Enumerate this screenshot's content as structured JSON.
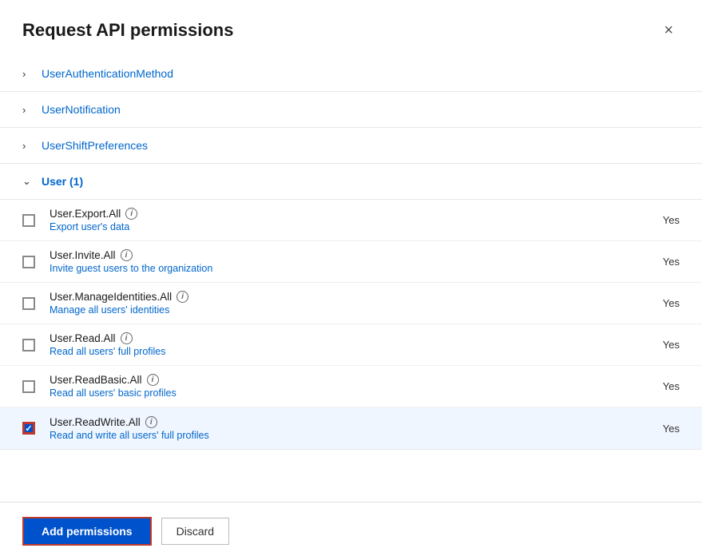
{
  "dialog": {
    "title": "Request API permissions",
    "close_label": "×"
  },
  "collapsed_sections": [
    {
      "id": "UserAuthenticationMethod",
      "label": "UserAuthenticationMethod",
      "expanded": false
    },
    {
      "id": "UserNotification",
      "label": "UserNotification",
      "expanded": false
    },
    {
      "id": "UserShiftPreferences",
      "label": "UserShiftPreferences",
      "expanded": false
    }
  ],
  "expanded_section": {
    "label": "User (1)",
    "permissions": [
      {
        "id": "User.Export.All",
        "name": "User.Export.All",
        "description": "Export user's data",
        "admin_consent": "Yes",
        "checked": false
      },
      {
        "id": "User.Invite.All",
        "name": "User.Invite.All",
        "description": "Invite guest users to the organization",
        "admin_consent": "Yes",
        "checked": false
      },
      {
        "id": "User.ManageIdentities.All",
        "name": "User.ManageIdentities.All",
        "description": "Manage all users' identities",
        "admin_consent": "Yes",
        "checked": false
      },
      {
        "id": "User.Read.All",
        "name": "User.Read.All",
        "description": "Read all users' full profiles",
        "admin_consent": "Yes",
        "checked": false
      },
      {
        "id": "User.ReadBasic.All",
        "name": "User.ReadBasic.All",
        "description": "Read all users' basic profiles",
        "admin_consent": "Yes",
        "checked": false
      },
      {
        "id": "User.ReadWrite.All",
        "name": "User.ReadWrite.All",
        "description": "Read and write all users' full profiles",
        "admin_consent": "Yes",
        "checked": true
      }
    ]
  },
  "footer": {
    "add_label": "Add permissions",
    "discard_label": "Discard"
  },
  "info_icon_label": "i"
}
